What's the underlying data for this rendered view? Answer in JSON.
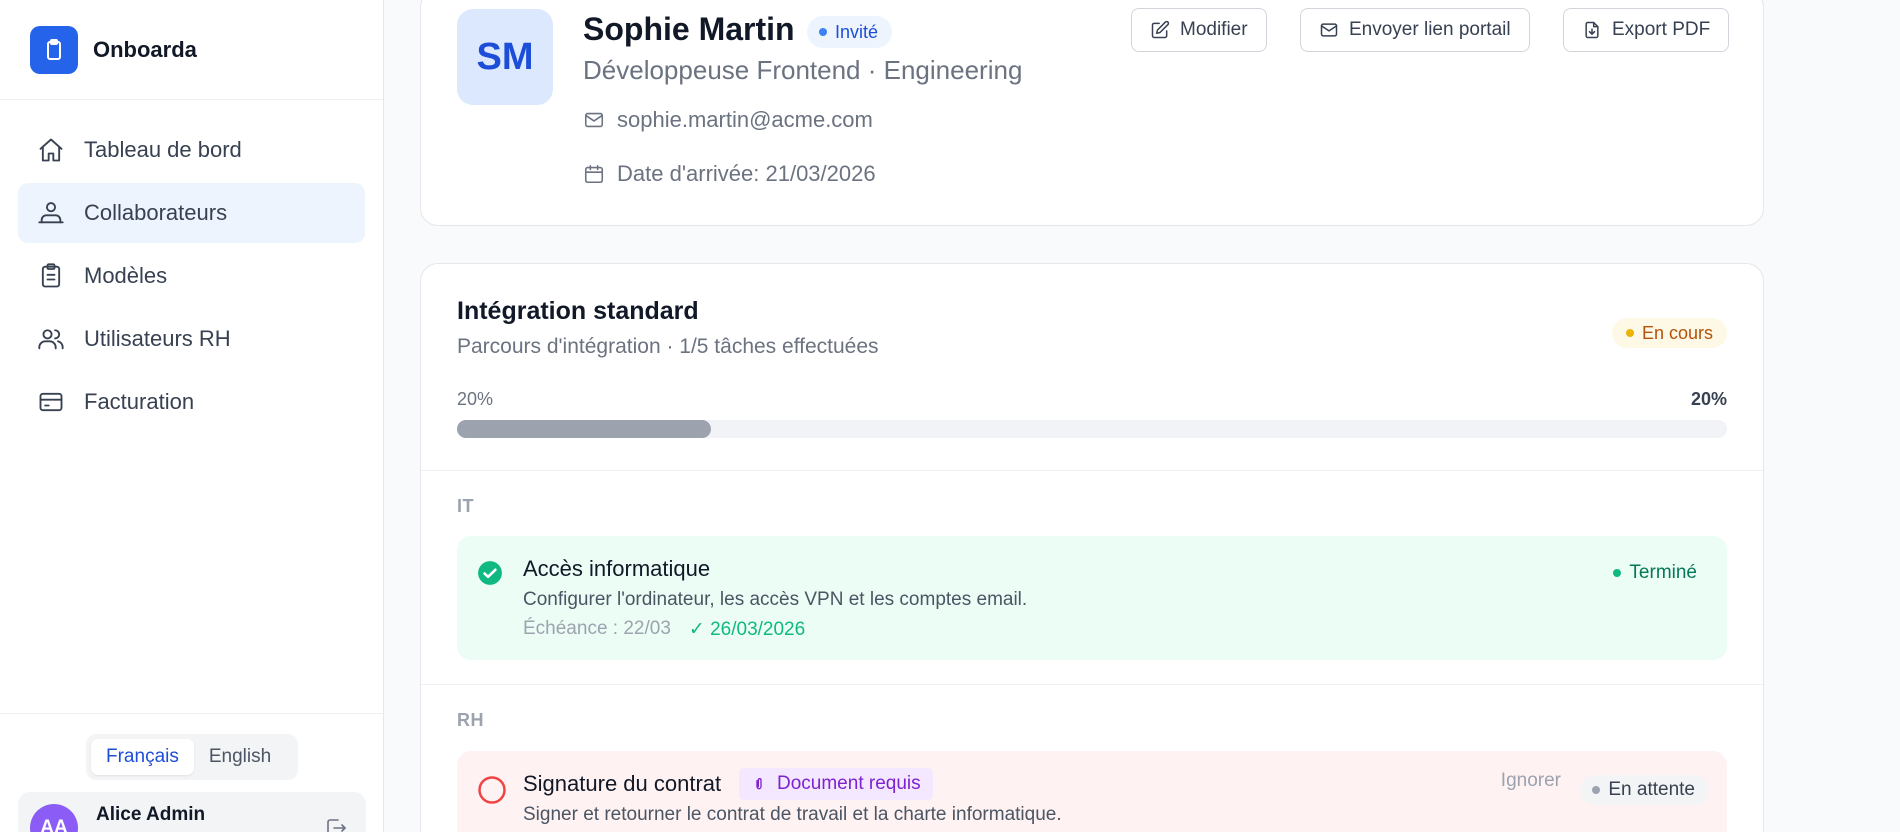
{
  "app": {
    "name": "Onboarda",
    "logo_icon": "clipboard-icon",
    "brand_color": "#2563eb"
  },
  "sidebar": {
    "items": [
      {
        "label": "Tableau de bord",
        "icon": "home-icon",
        "active": false
      },
      {
        "label": "Collaborateurs",
        "icon": "people-icon",
        "active": true
      },
      {
        "label": "Modèles",
        "icon": "clipboard-list-icon",
        "active": false
      },
      {
        "label": "Utilisateurs RH",
        "icon": "users-icon",
        "active": false
      },
      {
        "label": "Facturation",
        "icon": "credit-card-icon",
        "active": false
      }
    ],
    "languages": {
      "fr": "Français",
      "en": "English",
      "selected": "fr"
    },
    "user": {
      "initials": "AA",
      "name": "Alice Admin"
    }
  },
  "profile": {
    "initials": "SM",
    "name": "Sophie Martin",
    "status": "Invité",
    "role": "Développeuse Frontend · Engineering",
    "email": "sophie.martin@acme.com",
    "arrival": "Date d'arrivée: 21/03/2026",
    "actions": {
      "edit": "Modifier",
      "send_portal": "Envoyer lien portail",
      "export_pdf": "Export PDF"
    }
  },
  "program": {
    "title": "Intégration standard",
    "subtitle": "Parcours d'intégration · 1/5 tâches effectuées",
    "status": "En cours",
    "progress_left": "20%",
    "progress_right": "20%",
    "progress_fraction": 0.2,
    "sections": [
      {
        "label": "IT",
        "tasks": [
          {
            "title": "Accès informatique",
            "description": "Configurer l'ordinateur, les accès VPN et les comptes email.",
            "due": "Échéance : 22/03",
            "completed_on": "✓ 26/03/2026",
            "status": "Terminé"
          }
        ]
      },
      {
        "label": "RH",
        "tasks": [
          {
            "title": "Signature du contrat",
            "badge": "Document requis",
            "description": "Signer et retourner le contrat de travail et la charte informatique.",
            "ignore": "Ignorer",
            "status": "En attente"
          }
        ]
      }
    ]
  },
  "colors": {
    "accent": "#2563eb",
    "success": "#10b981",
    "warning": "#eab308",
    "pending": "#9ca3af",
    "danger_ring": "#ef4444"
  }
}
